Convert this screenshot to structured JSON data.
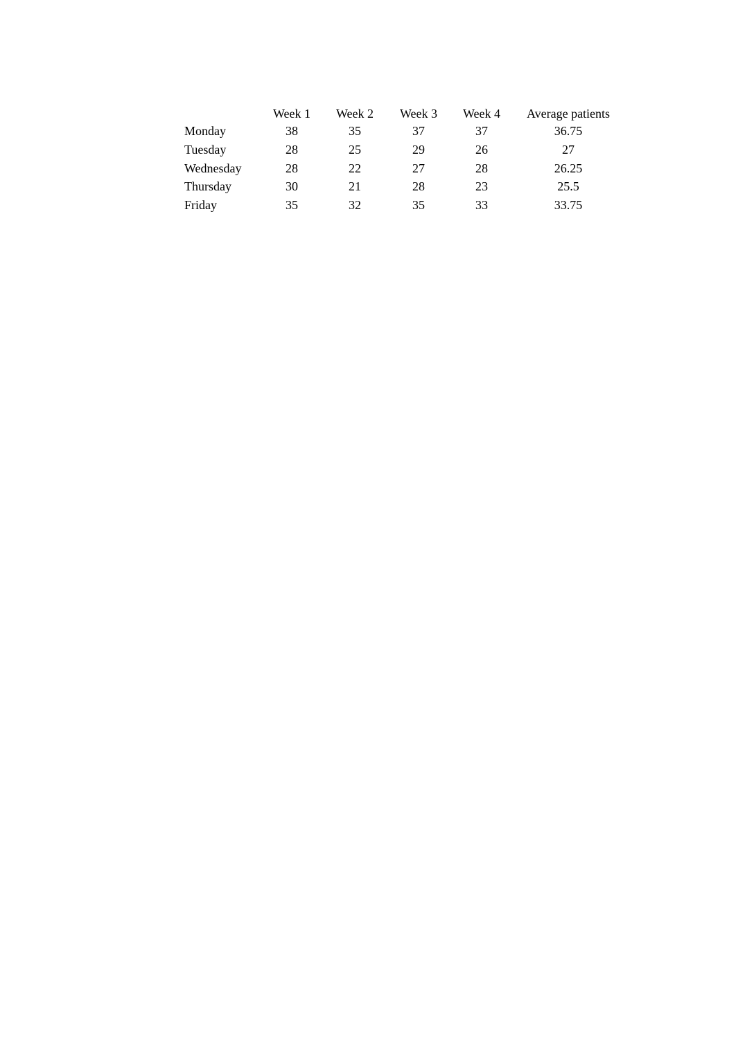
{
  "table": {
    "headers": [
      "",
      "Week 1",
      "Week 2",
      "Week 3",
      "Week 4",
      "Average patients"
    ],
    "rows": [
      {
        "day": "Monday",
        "w1": "38",
        "w2": "35",
        "w3": "37",
        "w4": "37",
        "avg": "36.75"
      },
      {
        "day": "Tuesday",
        "w1": "28",
        "w2": "25",
        "w3": "29",
        "w4": "26",
        "avg": "27"
      },
      {
        "day": "Wednesday",
        "w1": "28",
        "w2": "22",
        "w3": "27",
        "w4": "28",
        "avg": "26.25"
      },
      {
        "day": "Thursday",
        "w1": "30",
        "w2": "21",
        "w3": "28",
        "w4": "23",
        "avg": "25.5"
      },
      {
        "day": "Friday",
        "w1": "35",
        "w2": "32",
        "w3": "35",
        "w4": "33",
        "avg": "33.75"
      }
    ]
  }
}
